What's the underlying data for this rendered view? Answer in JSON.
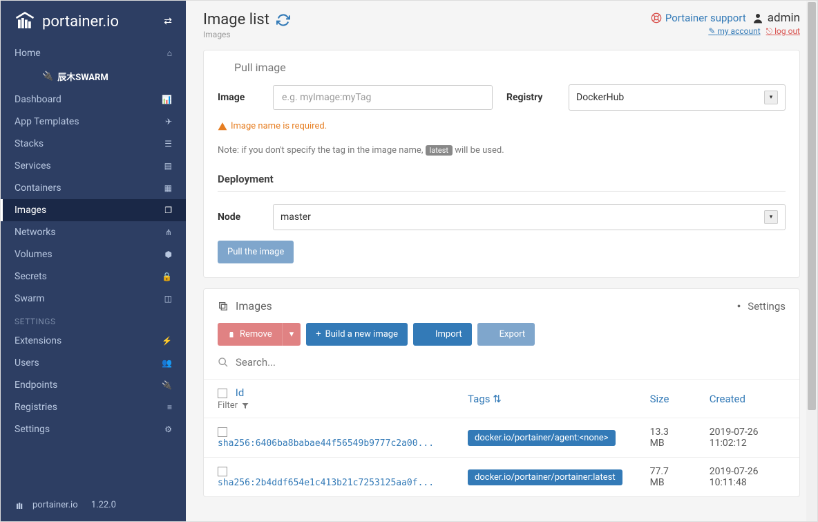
{
  "brand": "portainer.io",
  "version": "1.22.0",
  "endpoint_name": "辰木SWARM",
  "sidebar": {
    "items": [
      {
        "label": "Home",
        "icon": "home"
      },
      {
        "label": "Dashboard",
        "icon": "dashboard"
      },
      {
        "label": "App Templates",
        "icon": "rocket"
      },
      {
        "label": "Stacks",
        "icon": "list"
      },
      {
        "label": "Services",
        "icon": "list-alt"
      },
      {
        "label": "Containers",
        "icon": "cubes"
      },
      {
        "label": "Images",
        "icon": "clone",
        "active": true
      },
      {
        "label": "Networks",
        "icon": "sitemap"
      },
      {
        "label": "Volumes",
        "icon": "hdd"
      },
      {
        "label": "Secrets",
        "icon": "lock"
      },
      {
        "label": "Swarm",
        "icon": "object-group"
      }
    ],
    "settings_header": "SETTINGS",
    "settings_items": [
      {
        "label": "Extensions",
        "icon": "bolt"
      },
      {
        "label": "Users",
        "icon": "users"
      },
      {
        "label": "Endpoints",
        "icon": "plug"
      },
      {
        "label": "Registries",
        "icon": "database"
      },
      {
        "label": "Settings",
        "icon": "cogs"
      }
    ]
  },
  "header": {
    "title": "Image list",
    "breadcrumb": "Images",
    "support": "Portainer support",
    "user": "admin",
    "my_account": "my account",
    "logout": "log out"
  },
  "pull_panel": {
    "title": "Pull image",
    "image_label": "Image",
    "image_placeholder": "e.g. myImage:myTag",
    "registry_label": "Registry",
    "registry_value": "DockerHub",
    "warning": "Image name is required.",
    "note_pre": "Note: if you don't specify the tag in the image name, ",
    "note_tag": "latest",
    "note_post": " will be used.",
    "deployment_title": "Deployment",
    "node_label": "Node",
    "node_value": "master",
    "pull_button": "Pull the image"
  },
  "images_panel": {
    "title": "Images",
    "settings": "Settings",
    "remove": "Remove",
    "build": "Build a new image",
    "import": "Import",
    "export": "Export",
    "search_placeholder": "Search...",
    "col_id": "Id",
    "filter": "Filter",
    "col_tags": "Tags",
    "col_size": "Size",
    "col_created": "Created",
    "rows": [
      {
        "sha": "sha256:6406ba8babae44f56549b9777c2a00...",
        "tag": "docker.io/portainer/agent:<none>",
        "size": "13.3 MB",
        "created": "2019-07-26 11:02:12"
      },
      {
        "sha": "sha256:2b4ddf654e1c413b21c7253125aa0f...",
        "tag": "docker.io/portainer/portainer:latest",
        "size": "77.7 MB",
        "created": "2019-07-26 10:11:48"
      }
    ]
  }
}
